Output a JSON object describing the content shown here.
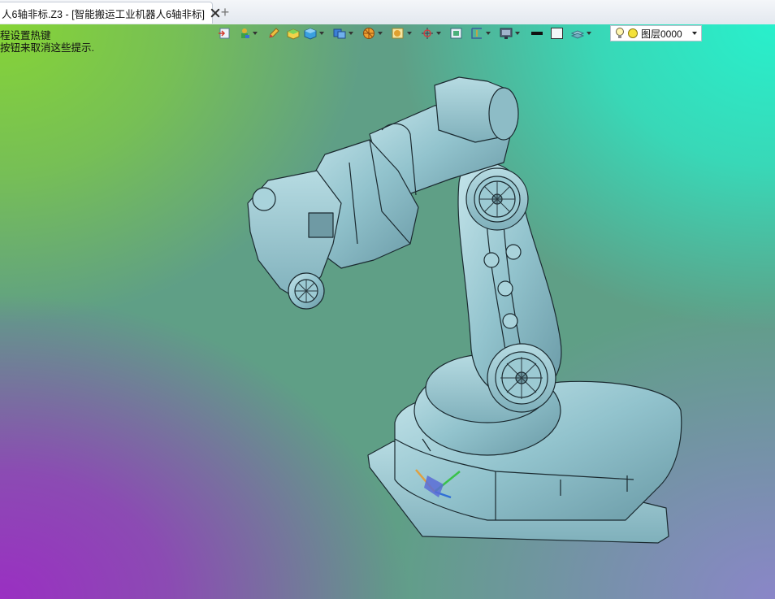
{
  "tab": {
    "title": "人6轴非标.Z3 - [智能搬运工业机器人6轴非标]"
  },
  "hint": {
    "line1": "程设置热键",
    "line2": "按钮来取消这些提示."
  },
  "toolbar": {
    "icons": [
      "import-icon",
      "color-picker-icon",
      "pencil-icon",
      "box-icon",
      "cube-icon",
      "view-cube-icon",
      "render-style-icon",
      "shading-icon",
      "snap-icon",
      "fit-view-icon",
      "dimension-icon",
      "display-icon",
      "line-color-icon",
      "fill-color-icon",
      "layer-stack-icon"
    ],
    "layer": {
      "value": "图层0000",
      "icons": [
        "bulb-icon",
        "layer-color-icon"
      ]
    }
  },
  "colors": {
    "robot_body": "#8fc3cd",
    "robot_edge": "#1b2a30",
    "accent_blue": "#2f6fd6"
  }
}
